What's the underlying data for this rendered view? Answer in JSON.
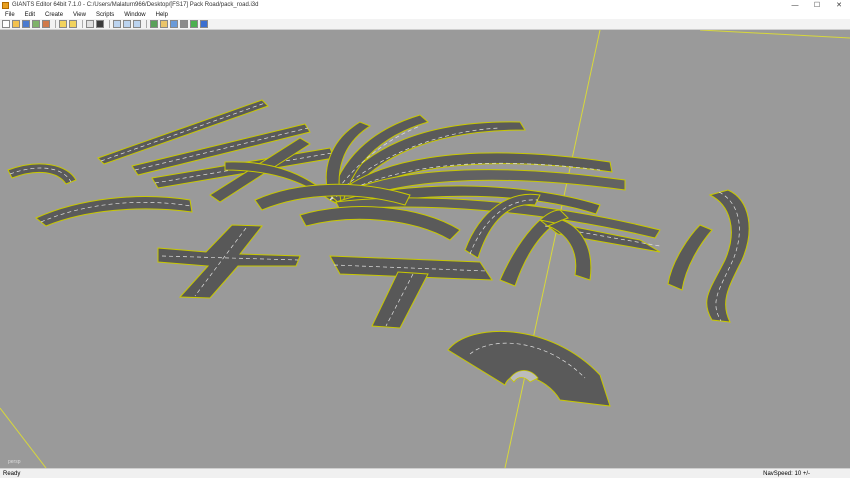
{
  "window": {
    "title": "GIANTS Editor 64bit 7.1.0 - C:/Users/Malaturn966/Desktop/[FS17] Pack Road/pack_road.i3d",
    "minimize_glyph": "—",
    "maximize_glyph": "☐",
    "close_glyph": "✕"
  },
  "menu": [
    "File",
    "Edit",
    "Create",
    "View",
    "Scripts",
    "Window",
    "Help"
  ],
  "toolbar": {
    "icons": [
      "new-icon",
      "open-icon",
      "save-icon",
      "import-icon",
      "export-icon",
      "undo-icon",
      "redo-icon",
      "select-icon",
      "play-icon",
      "move-icon",
      "scale-icon",
      "rotate-icon",
      "snap-icon",
      "grid-icon",
      "light-icon",
      "camera-icon",
      "terrain-icon",
      "help-icon"
    ]
  },
  "viewport": {
    "background_color": "#9a9a9a",
    "road_color": "#5a5a5a",
    "line_color": "#e2e2e2",
    "edge_color": "#c8c800",
    "axis_color": "#d8d83a",
    "camera_label": "persp"
  },
  "status": {
    "left": "Ready",
    "right": "NavSpeed: 10 +/-"
  }
}
